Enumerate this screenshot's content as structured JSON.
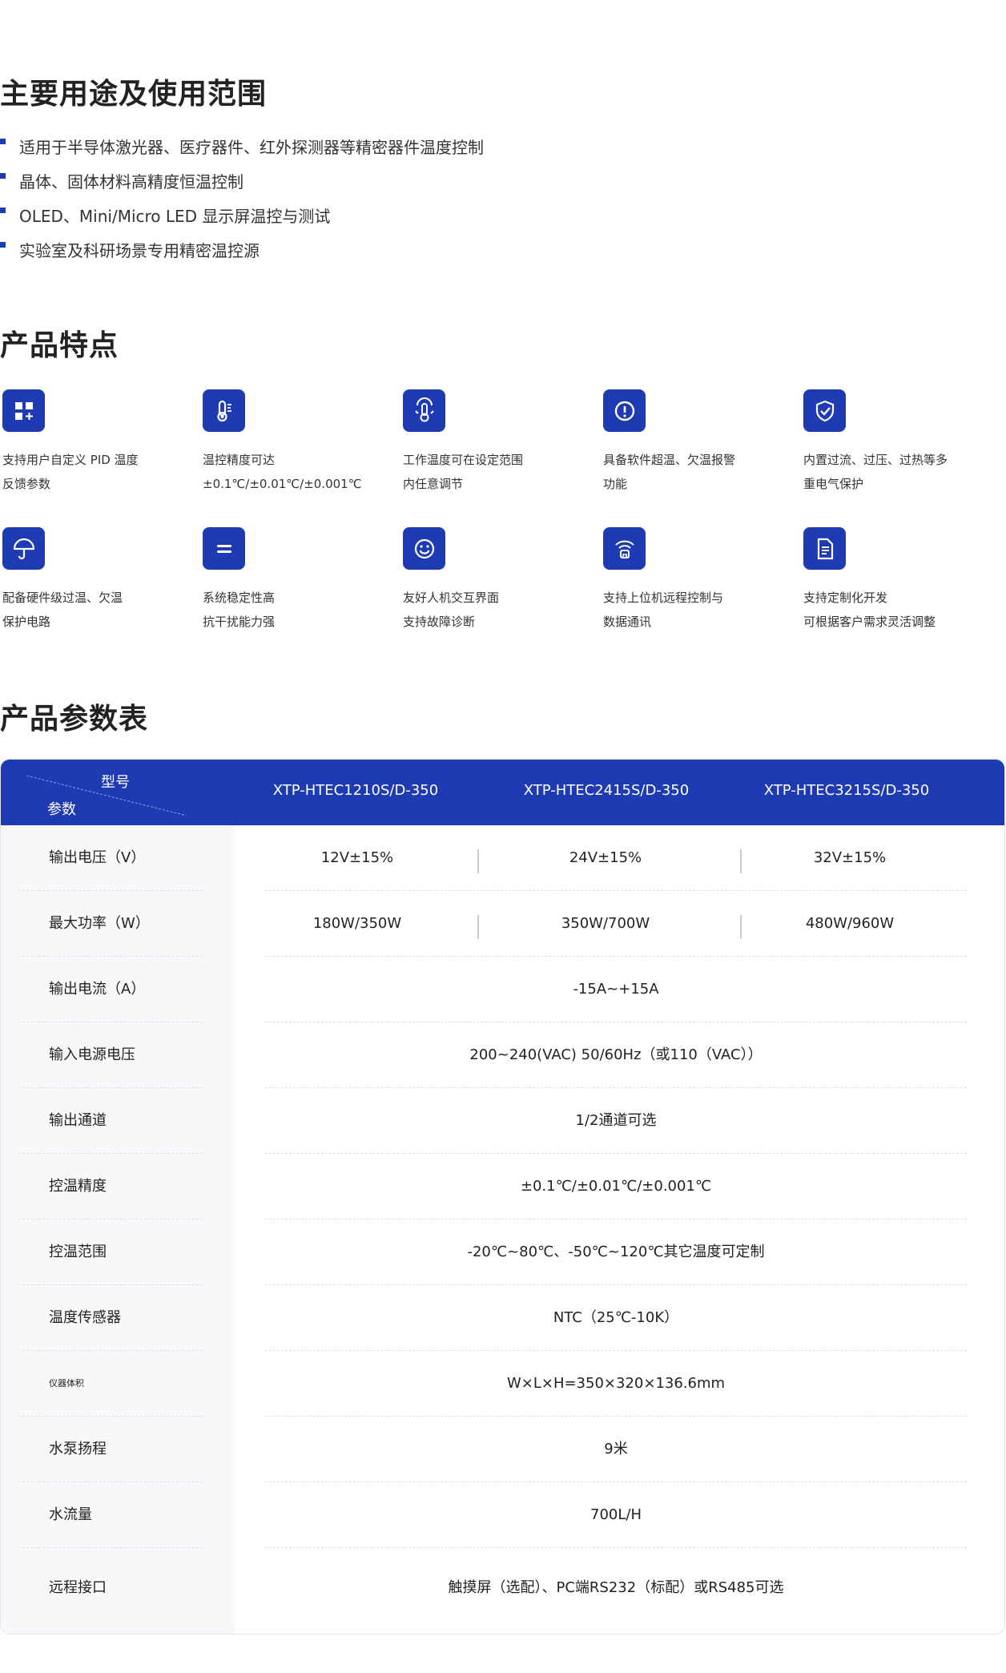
{
  "uses": {
    "title": "主要用途及使用范围",
    "items": [
      "适用于半导体激光器、医疗器件、红外探测器等精密器件温度控制",
      "晶体、固体材料高精度恒温控制",
      "OLED、Mini/Micro LED 显示屏温控与测试",
      "实验室及科研场景专用精密温控源"
    ]
  },
  "features": {
    "title": "产品特点",
    "items": [
      {
        "icon": "apps-grid-icon",
        "line1": "支持用户自定义 PID 温度",
        "line2": "反馈参数"
      },
      {
        "icon": "thermometer-icon",
        "line1": "温控精度可达",
        "line2": "±0.1℃/±0.01℃/±0.001℃"
      },
      {
        "icon": "temperature-range-icon",
        "line1": "工作温度可在设定范围",
        "line2": "内任意调节"
      },
      {
        "icon": "alert-circle-icon",
        "line1": "具备软件超温、欠温报警",
        "line2": "功能"
      },
      {
        "icon": "shield-check-icon",
        "line1": "内置过流、过压、过热等多",
        "line2": "重电气保护"
      },
      {
        "icon": "umbrella-icon",
        "line1": "配备硬件级过温、欠温",
        "line2": "保护电路"
      },
      {
        "icon": "equals-icon",
        "line1": "系统稳定性高",
        "line2": "抗干扰能力强"
      },
      {
        "icon": "smiley-icon",
        "line1": "友好人机交互界面",
        "line2": "支持故障诊断"
      },
      {
        "icon": "remote-signal-icon",
        "line1": "支持上位机远程控制与",
        "line2": "数据通讯"
      },
      {
        "icon": "document-icon",
        "line1": "支持定制化开发",
        "line2": "可根据客户需求灵活调整"
      }
    ]
  },
  "params": {
    "title": "产品参数表",
    "header": {
      "model_label": "型号",
      "param_label": "参数",
      "models": [
        "XTP-HTEC1210S/D-350",
        "XTP-HTEC2415S/D-350",
        "XTP-HTEC3215S/D-350"
      ]
    },
    "rows": [
      {
        "label": "输出电压（V）",
        "values": [
          "12V±15%",
          "24V±15%",
          "32V±15%"
        ]
      },
      {
        "label": "最大功率（W）",
        "values": [
          "180W/350W",
          "350W/700W",
          "480W/960W"
        ]
      },
      {
        "label": "输出电流（A）",
        "values": [
          "-15A~+15A"
        ]
      },
      {
        "label": "输入电源电压",
        "values": [
          "200~240(VAC) 50/60Hz（或110（VAC））"
        ]
      },
      {
        "label": "输出通道",
        "values": [
          "1/2通道可选"
        ]
      },
      {
        "label": "控温精度",
        "values": [
          "±0.1℃/±0.01℃/±0.001℃"
        ]
      },
      {
        "label": "控温范围",
        "values": [
          "-20℃~80℃、-50℃~120℃其它温度可定制"
        ]
      },
      {
        "label": "温度传感器",
        "values": [
          "NTC（25℃-10K）"
        ]
      },
      {
        "label": "仪器体积",
        "values": [
          "W×L×H=350×320×136.6mm"
        ]
      },
      {
        "label": "水泵扬程",
        "values": [
          "9米"
        ]
      },
      {
        "label": "水流量",
        "values": [
          "700L/H"
        ]
      },
      {
        "label": "远程接口",
        "values": [
          "触摸屏（选配）、PC端RS232（标配）或RS485可选"
        ]
      }
    ]
  },
  "colors": {
    "accent": "#1f3bb3",
    "label_bg": "#f7f8fa"
  }
}
